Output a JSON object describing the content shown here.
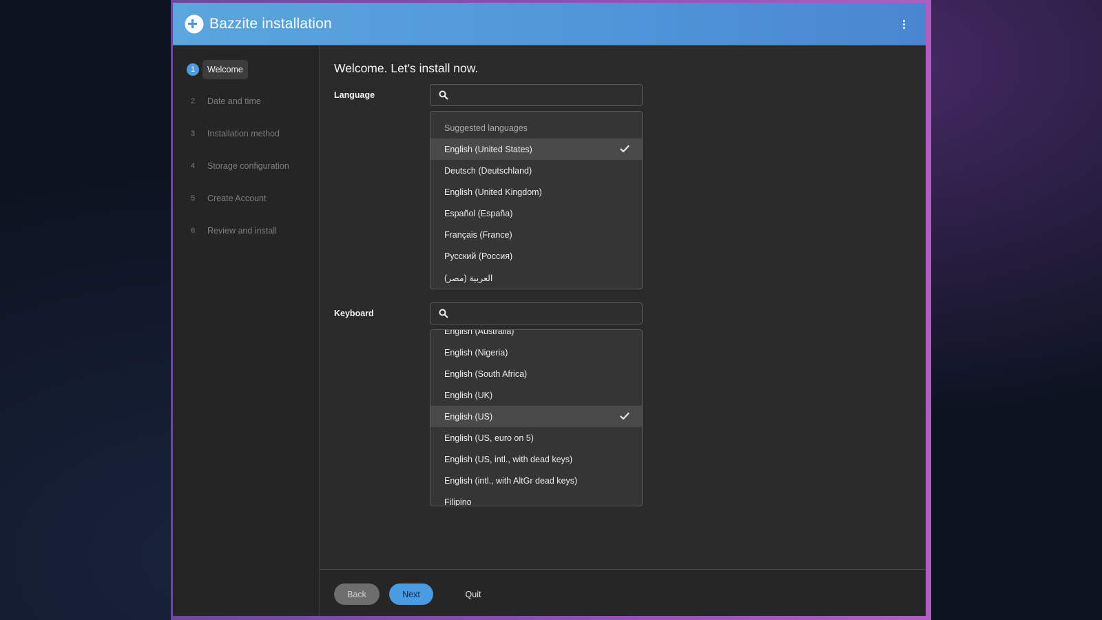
{
  "window": {
    "title": "Bazzite installation",
    "menu_icon": "kebab-menu-icon",
    "logo_icon": "bazzite-logo-icon"
  },
  "colors": {
    "header": "#4f95d8",
    "accent": "#4a9be0",
    "background": "#2b2b2b",
    "sidebar": "#252525"
  },
  "sidebar": {
    "steps": [
      {
        "num": "1",
        "label": "Welcome",
        "active": true
      },
      {
        "num": "2",
        "label": "Date and time",
        "active": false
      },
      {
        "num": "3",
        "label": "Installation method",
        "active": false
      },
      {
        "num": "4",
        "label": "Storage configuration",
        "active": false
      },
      {
        "num": "5",
        "label": "Create Account",
        "active": false
      },
      {
        "num": "6",
        "label": "Review and install",
        "active": false
      }
    ]
  },
  "main": {
    "title": "Welcome. Let's install now.",
    "language": {
      "label": "Language",
      "search_value": "",
      "group_header": "Suggested languages",
      "options": [
        "English (United States)",
        "Deutsch (Deutschland)",
        "English (United Kingdom)",
        "Español (España)",
        "Français (France)",
        "Русский (Россия)",
        "العربية (مصر)"
      ],
      "selected": "English (United States)"
    },
    "keyboard": {
      "label": "Keyboard",
      "search_value": "",
      "options": [
        "English (Australia)",
        "English (Nigeria)",
        "English (South Africa)",
        "English (UK)",
        "English (US)",
        "English (US, euro on 5)",
        "English (US, intl., with dead keys)",
        "English (intl., with AltGr dead keys)",
        "Filipino"
      ],
      "selected": "English (US)"
    }
  },
  "footer": {
    "back_label": "Back",
    "next_label": "Next",
    "quit_label": "Quit"
  }
}
